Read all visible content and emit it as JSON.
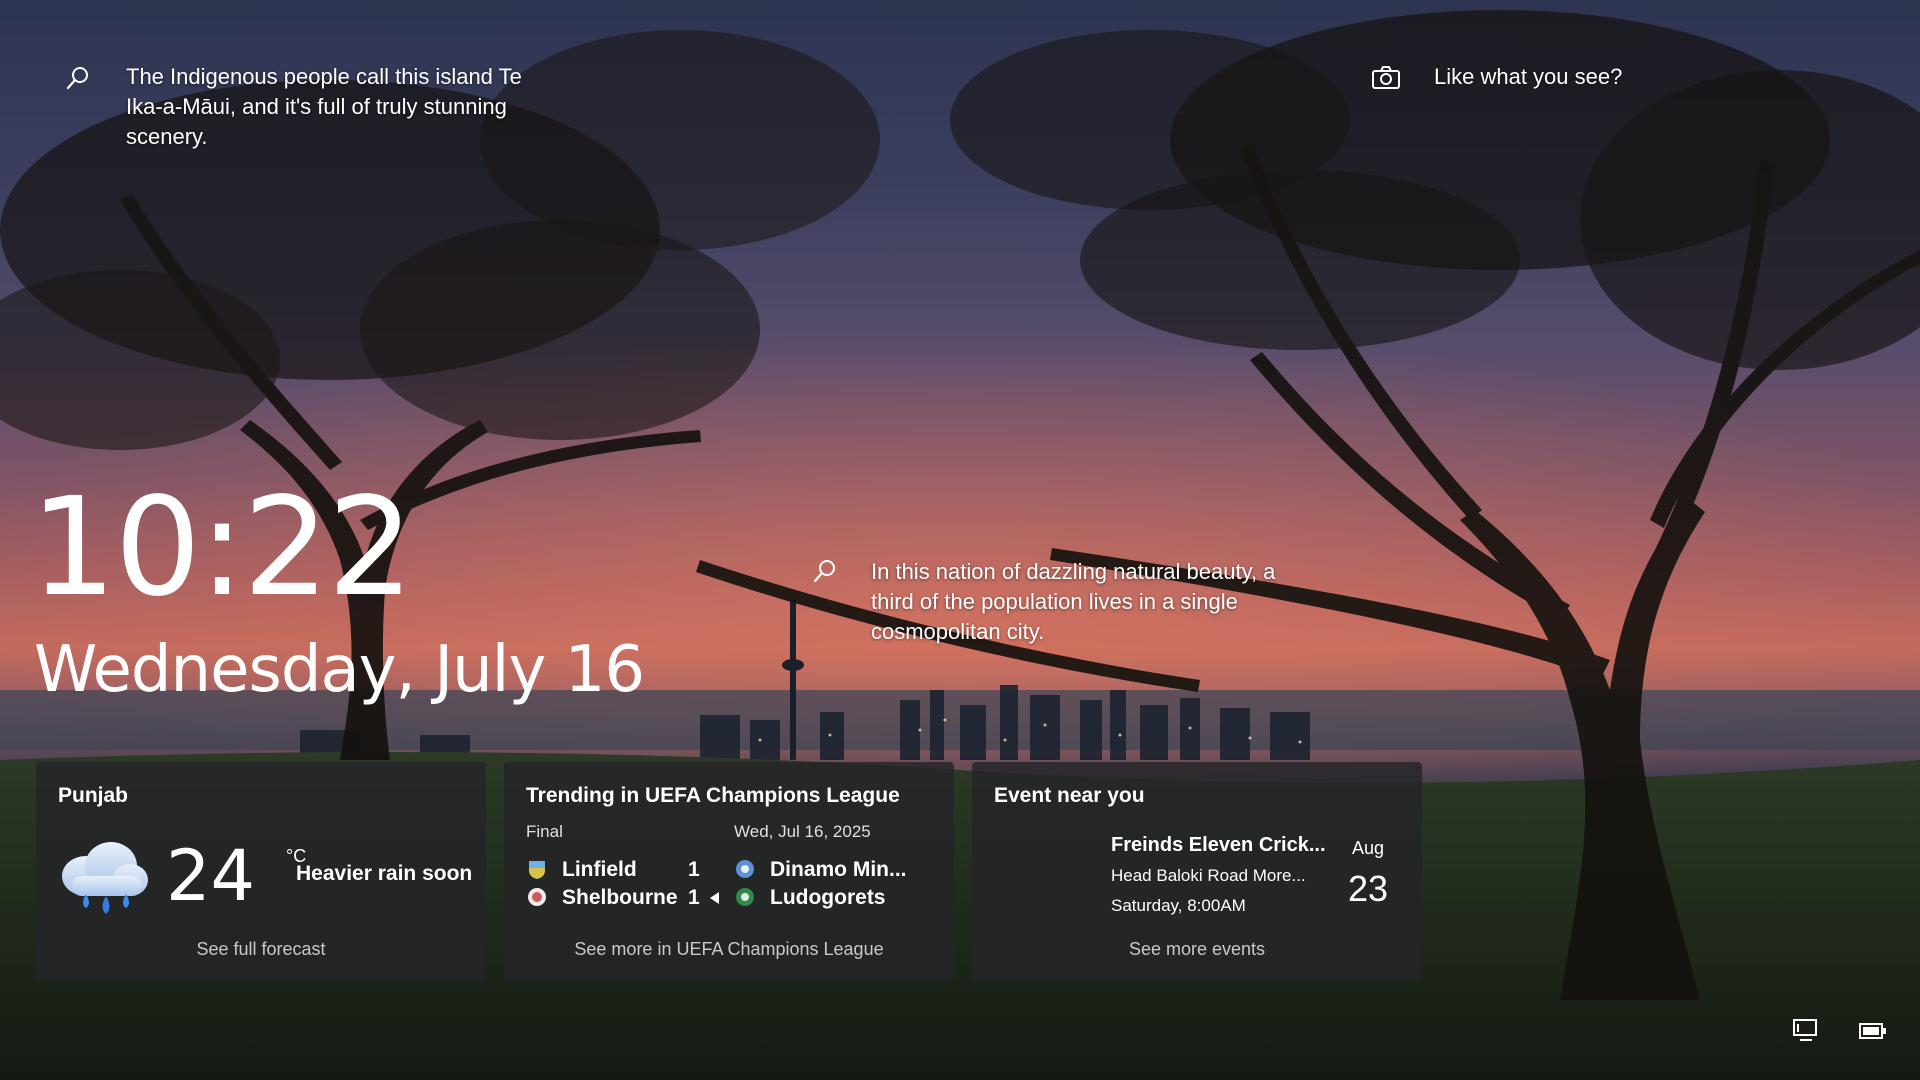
{
  "spotlight": {
    "top_left_text": "The Indigenous people call this island Te Ika-a-Māui, and it's full of truly stunning scenery.",
    "center_text": "In this nation of dazzling natural beauty, a third of the population lives in a single cosmopolitan city.",
    "like_text": "Like what you see?",
    "icons": [
      "search-icon",
      "search-icon",
      "camera-icon"
    ]
  },
  "clock": {
    "time": "10:22",
    "date": "Wednesday, July 16"
  },
  "weather": {
    "location": "Punjab",
    "temperature": "24",
    "unit": "°C",
    "condition": "Heavier rain soon",
    "footer": "See full forecast",
    "icon": "rain-cloud-icon"
  },
  "sports": {
    "title": "Trending in UEFA Champions League",
    "status": "Final",
    "date": "Wed, Jul 16, 2025",
    "home": [
      {
        "team": "Linfield",
        "score": "1"
      },
      {
        "team": "Shelbourne",
        "score": "1"
      }
    ],
    "away": [
      {
        "team": "Dinamo Min..."
      },
      {
        "team": "Ludogorets"
      }
    ],
    "footer": "See more in UEFA Champions League"
  },
  "event": {
    "title": "Event near you",
    "name": "Freinds Eleven Crick...",
    "location": "Head Baloki Road More...",
    "time": "Saturday, 8:00AM",
    "month": "Aug",
    "day": "23",
    "footer": "See more events"
  },
  "colors": {
    "card_bg": "#242428",
    "text": "#ffffff",
    "muted": "#c9c9c9"
  }
}
